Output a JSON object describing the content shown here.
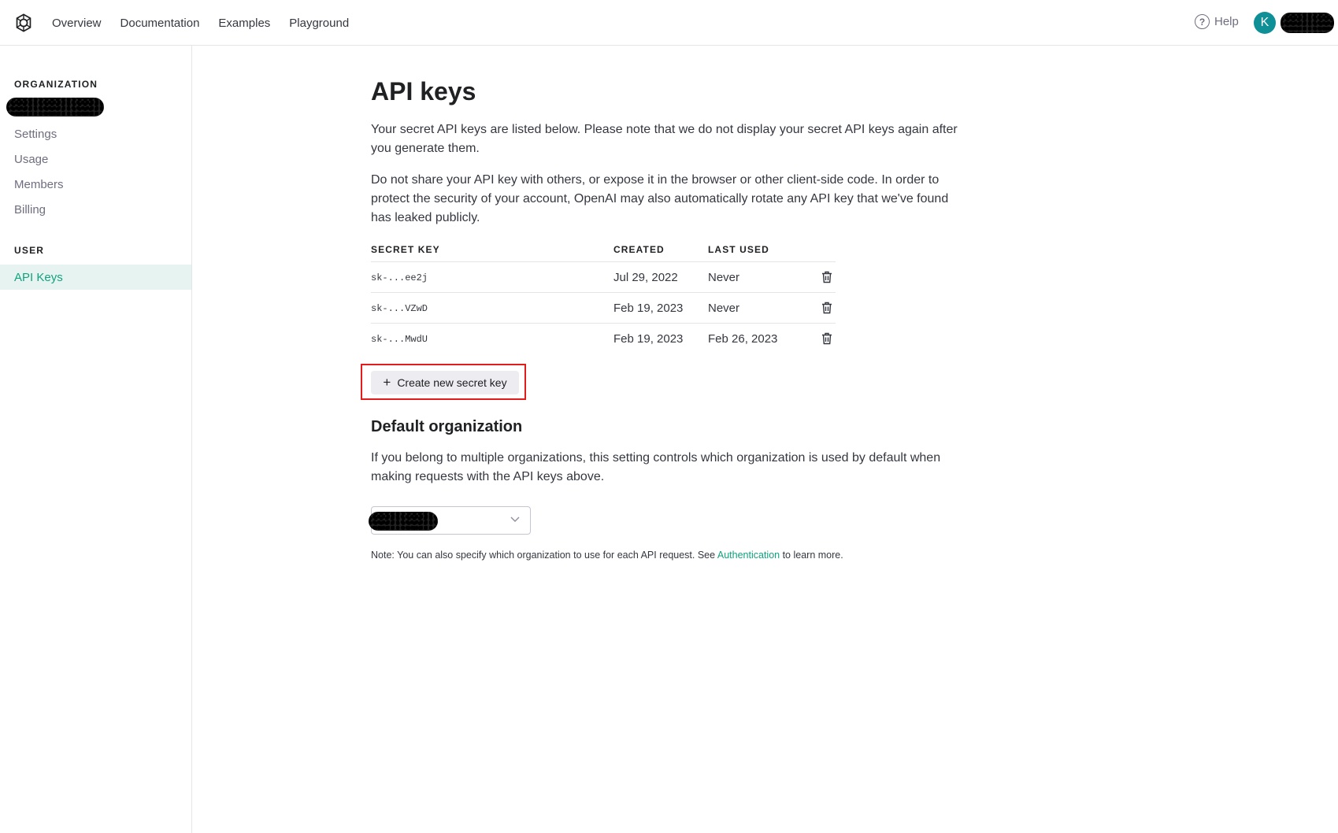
{
  "nav": {
    "links": [
      "Overview",
      "Documentation",
      "Examples",
      "Playground"
    ],
    "help_label": "Help",
    "avatar_initial": "K"
  },
  "sidebar": {
    "org_heading": "ORGANIZATION",
    "org_items": [
      "Settings",
      "Usage",
      "Members",
      "Billing"
    ],
    "user_heading": "USER",
    "user_items": [
      "API Keys"
    ],
    "active_item": "API Keys"
  },
  "main": {
    "title": "API keys",
    "intro": "Your secret API keys are listed below. Please note that we do not display your secret API keys again after you generate them.",
    "warning": "Do not share your API key with others, or expose it in the browser or other client-side code. In order to protect the security of your account, OpenAI may also automatically rotate any API key that we've found has leaked publicly.",
    "table": {
      "headers": [
        "SECRET KEY",
        "CREATED",
        "LAST USED"
      ],
      "rows": [
        {
          "key": "sk-...ee2j",
          "created": "Jul 29, 2022",
          "last_used": "Never"
        },
        {
          "key": "sk-...VZwD",
          "created": "Feb 19, 2023",
          "last_used": "Never"
        },
        {
          "key": "sk-...MwdU",
          "created": "Feb 19, 2023",
          "last_used": "Feb 26, 2023"
        }
      ]
    },
    "create_button": "Create new secret key",
    "default_org": {
      "title": "Default organization",
      "description": "If you belong to multiple organizations, this setting controls which organization is used by default when making requests with the API keys above.",
      "note_prefix": "Note: You can also specify which organization to use for each API request. See ",
      "note_link": "Authentication",
      "note_suffix": " to learn more."
    }
  },
  "colors": {
    "accent": "#10a37f",
    "highlight_box": "#e21b1b",
    "active_bg": "#e6f3f1"
  }
}
